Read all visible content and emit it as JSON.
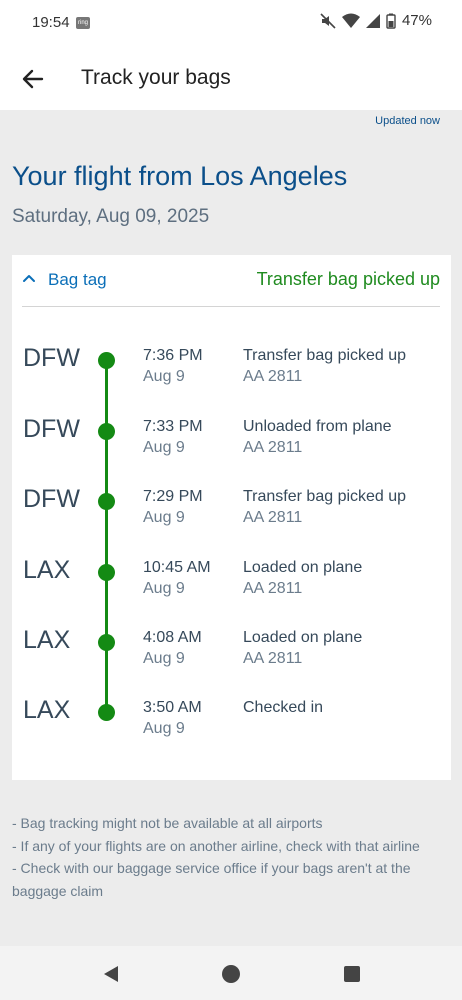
{
  "status_bar": {
    "time": "19:54",
    "ring_label": "ring",
    "battery": "47%"
  },
  "header": {
    "title": "Track your bags",
    "back_icon": "arrow-left-icon"
  },
  "updated_label": "Updated now",
  "flight": {
    "title": "Your flight from Los Angeles",
    "date": "Saturday, Aug 09, 2025"
  },
  "bag_tag": {
    "label": "Bag tag",
    "status": "Transfer bag picked up"
  },
  "events": [
    {
      "airport": "DFW",
      "time": "7:36 PM",
      "date": "Aug 9",
      "description": "Transfer bag picked up",
      "flight": "AA 2811"
    },
    {
      "airport": "DFW",
      "time": "7:33 PM",
      "date": "Aug 9",
      "description": "Unloaded from plane",
      "flight": "AA 2811"
    },
    {
      "airport": "DFW",
      "time": "7:29 PM",
      "date": "Aug 9",
      "description": "Transfer bag picked up",
      "flight": "AA 2811"
    },
    {
      "airport": "LAX",
      "time": "10:45 AM",
      "date": "Aug 9",
      "description": "Loaded on plane",
      "flight": "AA 2811"
    },
    {
      "airport": "LAX",
      "time": "4:08 AM",
      "date": "Aug 9",
      "description": "Loaded on plane",
      "flight": "AA 2811"
    },
    {
      "airport": "LAX",
      "time": "3:50 AM",
      "date": "Aug 9",
      "description": "Checked in",
      "flight": ""
    }
  ],
  "notes": [
    "- Bag tracking might not be available at all airports",
    "- If any of your flights are on another airline, check with that airline",
    "- Check with our baggage service office if your bags aren't at the baggage claim"
  ],
  "colors": {
    "brand_blue": "#0b4f8a",
    "link_blue": "#0b6fb8",
    "status_green": "#1f8b1f",
    "timeline_green": "#148a14"
  }
}
